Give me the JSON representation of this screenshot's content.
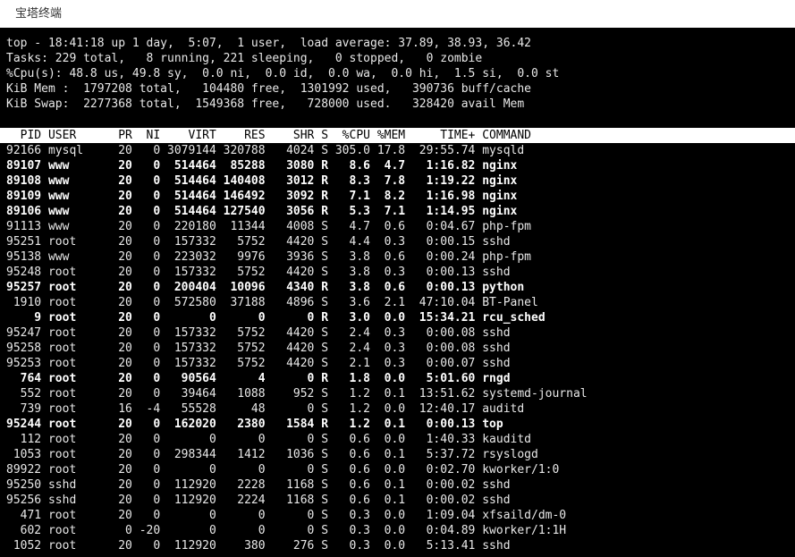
{
  "window": {
    "title": "宝塔终端"
  },
  "summary": [
    "top - 18:41:18 up 1 day,  5:07,  1 user,  load average: 37.89, 38.93, 36.42",
    "Tasks: 229 total,   8 running, 221 sleeping,   0 stopped,   0 zombie",
    "%Cpu(s): 48.8 us, 49.8 sy,  0.0 ni,  0.0 id,  0.0 wa,  0.0 hi,  1.5 si,  0.0 st",
    "KiB Mem :  1797208 total,   104480 free,  1301992 used,   390736 buff/cache",
    "KiB Swap:  2277368 total,  1549368 free,   728000 used.   328420 avail Mem"
  ],
  "header": "  PID USER      PR  NI    VIRT    RES    SHR S  %CPU %MEM     TIME+ COMMAND",
  "processes": [
    {
      "text": "92166 mysql     20   0 3079144 320788   4024 S 305.0 17.8  29:55.74 mysqld",
      "bold": false
    },
    {
      "text": "89107 www       20   0  514464  85288   3080 R   8.6  4.7   1:16.82 nginx",
      "bold": true
    },
    {
      "text": "89108 www       20   0  514464 140408   3012 R   8.3  7.8   1:19.22 nginx",
      "bold": true
    },
    {
      "text": "89109 www       20   0  514464 146492   3092 R   7.1  8.2   1:16.98 nginx",
      "bold": true
    },
    {
      "text": "89106 www       20   0  514464 127540   3056 R   5.3  7.1   1:14.95 nginx",
      "bold": true
    },
    {
      "text": "91113 www       20   0  220180  11344   4008 S   4.7  0.6   0:04.67 php-fpm",
      "bold": false
    },
    {
      "text": "95251 root      20   0  157332   5752   4420 S   4.4  0.3   0:00.15 sshd",
      "bold": false
    },
    {
      "text": "95138 www       20   0  223032   9976   3936 S   3.8  0.6   0:00.24 php-fpm",
      "bold": false
    },
    {
      "text": "95248 root      20   0  157332   5752   4420 S   3.8  0.3   0:00.13 sshd",
      "bold": false
    },
    {
      "text": "95257 root      20   0  200404  10096   4340 R   3.8  0.6   0:00.13 python",
      "bold": true
    },
    {
      "text": " 1910 root      20   0  572580  37188   4896 S   3.6  2.1  47:10.04 BT-Panel",
      "bold": false
    },
    {
      "text": "    9 root      20   0       0      0      0 R   3.0  0.0  15:34.21 rcu_sched",
      "bold": true
    },
    {
      "text": "95247 root      20   0  157332   5752   4420 S   2.4  0.3   0:00.08 sshd",
      "bold": false
    },
    {
      "text": "95258 root      20   0  157332   5752   4420 S   2.4  0.3   0:00.08 sshd",
      "bold": false
    },
    {
      "text": "95253 root      20   0  157332   5752   4420 S   2.1  0.3   0:00.07 sshd",
      "bold": false
    },
    {
      "text": "  764 root      20   0   90564      4      0 R   1.8  0.0   5:01.60 rngd",
      "bold": true
    },
    {
      "text": "  552 root      20   0   39464   1088    952 S   1.2  0.1  13:51.62 systemd-journal",
      "bold": false
    },
    {
      "text": "  739 root      16  -4   55528     48      0 S   1.2  0.0  12:40.17 auditd",
      "bold": false
    },
    {
      "text": "95244 root      20   0  162020   2380   1584 R   1.2  0.1   0:00.13 top",
      "bold": true
    },
    {
      "text": "  112 root      20   0       0      0      0 S   0.6  0.0   1:40.33 kauditd",
      "bold": false
    },
    {
      "text": " 1053 root      20   0  298344   1412   1036 S   0.6  0.1   5:37.72 rsyslogd",
      "bold": false
    },
    {
      "text": "89922 root      20   0       0      0      0 S   0.6  0.0   0:02.70 kworker/1:0",
      "bold": false
    },
    {
      "text": "95250 sshd      20   0  112920   2228   1168 S   0.6  0.1   0:00.02 sshd",
      "bold": false
    },
    {
      "text": "95256 sshd      20   0  112920   2224   1168 S   0.6  0.1   0:00.02 sshd",
      "bold": false
    },
    {
      "text": "  471 root      20   0       0      0      0 S   0.3  0.0   1:09.04 xfsaild/dm-0",
      "bold": false
    },
    {
      "text": "  602 root       0 -20       0      0      0 S   0.3  0.0   0:04.89 kworker/1:1H",
      "bold": false
    },
    {
      "text": " 1052 root      20   0  112920    380    276 S   0.3  0.0   5:13.41 sshd",
      "bold": false
    }
  ]
}
